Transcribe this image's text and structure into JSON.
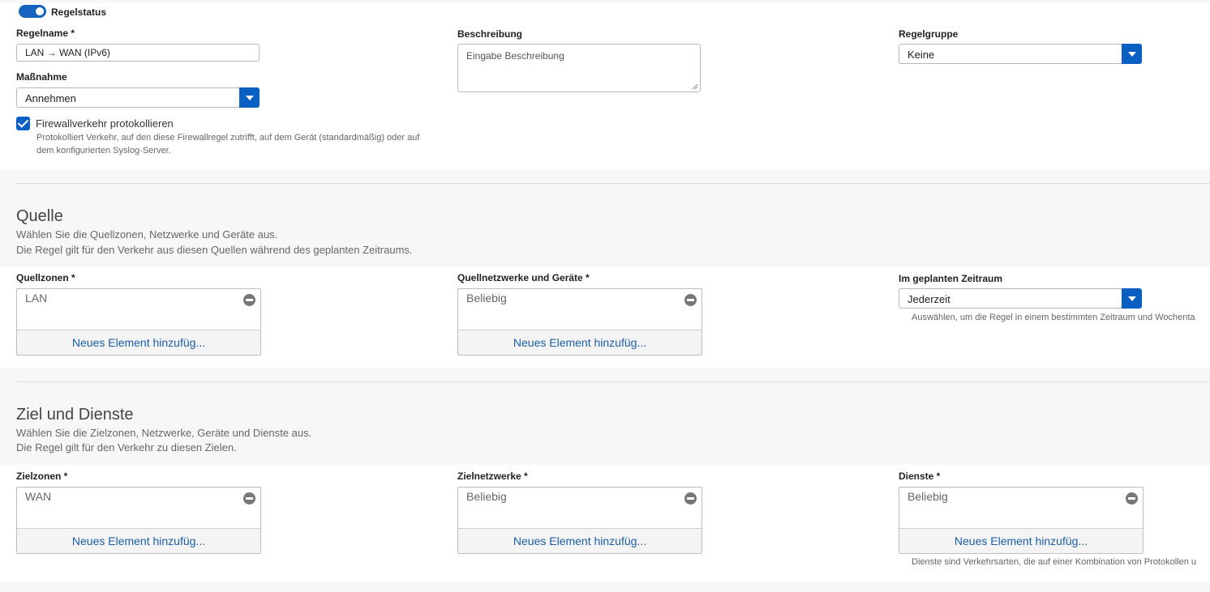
{
  "rule": {
    "status_label": "Regelstatus",
    "status_on": true,
    "name_label": "Regelname *",
    "name_value": "LAN → WAN (IPv6)",
    "action_label": "Maßnahme",
    "action_value": "Annehmen",
    "log_label": "Firewallverkehr protokollieren",
    "log_checked": true,
    "log_help_line1": "Protokolliert Verkehr, auf den diese Firewallregel zutrifft, auf dem Gerät (standardmäßig) oder auf",
    "log_help_line2": "dem konfigurierten Syslog-Server.",
    "description_label": "Beschreibung",
    "description_placeholder": "Eingabe Beschreibung",
    "group_label": "Regelgruppe",
    "group_value": "Keine"
  },
  "source": {
    "title": "Quelle",
    "desc_line1": "Wählen Sie die Quellzonen, Netzwerke und Geräte aus.",
    "desc_line2": "Die Regel gilt für den Verkehr aus diesen Quellen während des geplanten Zeitraums.",
    "zones_label": "Quellzonen *",
    "zones_item": "LAN",
    "zones_add": "Neues Element hinzufüg...",
    "networks_label": "Quellnetzwerke und Geräte *",
    "networks_item": "Beliebig",
    "networks_add": "Neues Element hinzufüg...",
    "schedule_label": "Im geplanten Zeitraum",
    "schedule_value": "Jederzeit",
    "schedule_help": "Auswählen, um die Regel in einem bestimmten Zeitraum und Wochenta"
  },
  "destination": {
    "title": "Ziel und Dienste",
    "desc_line1": "Wählen Sie die Zielzonen, Netzwerke, Geräte und Dienste aus.",
    "desc_line2": "Die Regel gilt für den Verkehr zu diesen Zielen.",
    "zones_label": "Zielzonen *",
    "zones_item": "WAN",
    "zones_add": "Neues Element hinzufüg...",
    "networks_label": "Zielnetzwerke *",
    "networks_item": "Beliebig",
    "networks_add": "Neues Element hinzufüg...",
    "services_label": "Dienste *",
    "services_item": "Beliebig",
    "services_add": "Neues Element hinzufüg...",
    "services_help": "Dienste sind Verkehrsarten, die auf einer Kombination von Protokollen u"
  }
}
